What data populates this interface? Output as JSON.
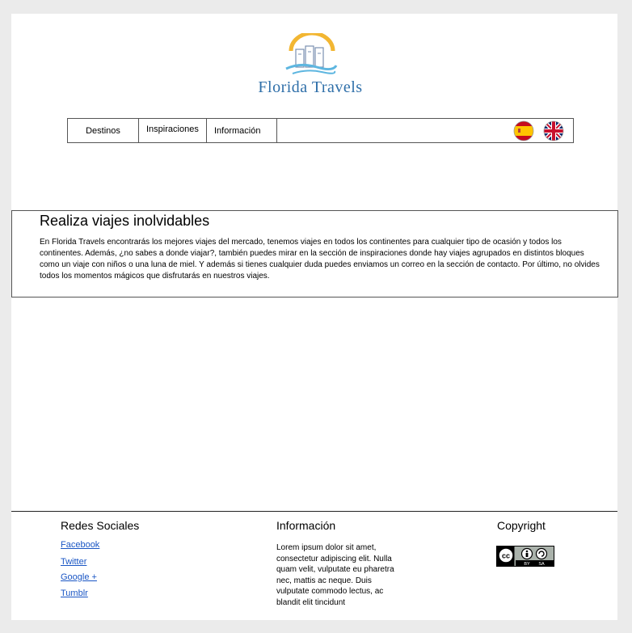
{
  "brand": {
    "name": "Florida Travels",
    "colors": {
      "blue": "#2f6fa9",
      "sun": "#f2b632",
      "water": "#5db6e0"
    }
  },
  "nav": {
    "items": [
      {
        "label": "Destinos"
      },
      {
        "label": "Inspiraciones"
      },
      {
        "label": "Información"
      }
    ],
    "languages": [
      {
        "icon": "spain-flag-icon"
      },
      {
        "icon": "uk-flag-icon"
      }
    ]
  },
  "intro": {
    "title": "Realiza viajes inolvidables",
    "body": "En Florida Travels encontrarás los mejores viajes del mercado, tenemos viajes en todos los continentes para cualquier tipo de ocasión y todos los continentes. Además, ¿no sabes a donde viajar?, también puedes mirar en la sección de inspiraciones donde hay viajes agrupados en distintos bloques como un viaje con niños o una luna de miel. Y además si tienes cualquier duda puedes enviamos un correo en la sección de contacto. Por último, no olvides todos los momentos mágicos que disfrutarás en nuestros viajes."
  },
  "footer": {
    "social": {
      "title": "Redes Sociales",
      "links": [
        "Facebook",
        "Twitter",
        "Google  +",
        "Tumblr  "
      ]
    },
    "info": {
      "title": "Información",
      "text": "Lorem ipsum dolor sit amet, consectetur adipiscing elit. Nulla quam velit, vulputate eu pharetra nec, mattis ac neque. Duis vulputate commodo lectus, ac blandit elit tincidunt"
    },
    "copyright": {
      "title": "Copyright",
      "badge_icon": "cc-by-sa-icon",
      "badge_text": [
        "cc",
        "BY",
        "SA"
      ]
    }
  }
}
